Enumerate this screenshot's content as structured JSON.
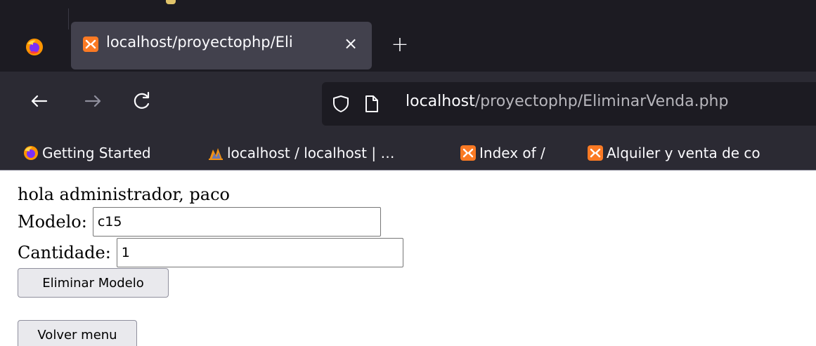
{
  "browser": {
    "tab": {
      "title": "localhost/proyectophp/Eli",
      "close_symbol": "×"
    },
    "new_tab_symbol": "+",
    "url": {
      "host": "localhost",
      "path": "/proyectophp/EliminarVenda.php"
    },
    "bookmarks": [
      {
        "label": "Getting Started",
        "icon": "firefox-icon"
      },
      {
        "label": "localhost / localhost | …",
        "icon": "phpmyadmin-icon"
      },
      {
        "label": "Index of /",
        "icon": "xampp-icon"
      },
      {
        "label": "Alquiler y venta de co",
        "icon": "xampp-icon"
      }
    ]
  },
  "page": {
    "greeting": "hola administrador, paco",
    "modelo": {
      "label": "Modelo:",
      "value": "c15"
    },
    "cantidade": {
      "label": "Cantidade:",
      "value": "1"
    },
    "eliminar_button": "Eliminar Modelo",
    "volver_button": "Volver menu"
  },
  "colors": {
    "tabbar_bg": "#1c1b22",
    "navbar_bg": "#2b2a33",
    "active_tab_bg": "#42414d",
    "xampp_orange": "#fb7a24"
  }
}
